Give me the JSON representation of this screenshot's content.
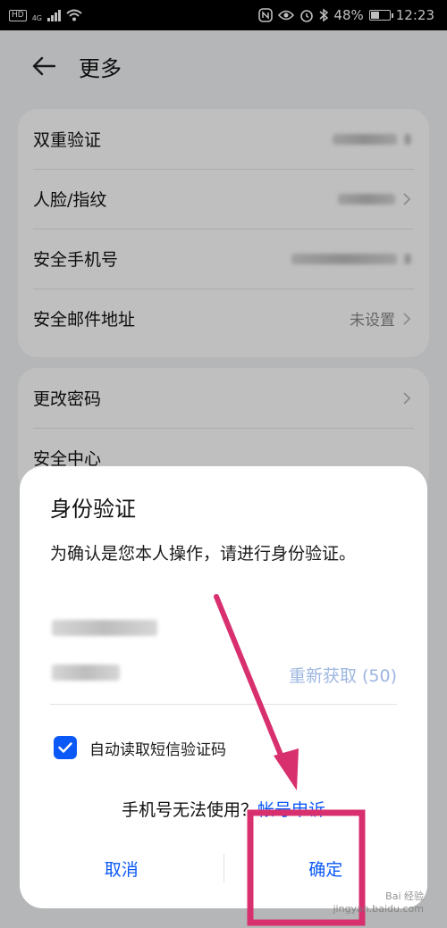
{
  "status_bar": {
    "tag": "HD",
    "network": "4G",
    "battery": "48%",
    "battery_level": 0.48,
    "time": "12:23",
    "icons": [
      "hd-icon",
      "signal-icon",
      "wifi-icon",
      "nfc-icon",
      "eye-icon",
      "alarm-icon",
      "bluetooth-icon",
      "battery-icon"
    ]
  },
  "header": {
    "title": "更多"
  },
  "security_items": [
    {
      "label": "双重验证"
    },
    {
      "label": "人脸/指纹"
    },
    {
      "label": "安全手机号"
    },
    {
      "label": "安全邮件地址",
      "value": "未设置"
    }
  ],
  "other_items": [
    {
      "label": "更改密码"
    },
    {
      "label": "安全中心"
    }
  ],
  "dialog": {
    "title": "身份验证",
    "description": "为确认是您本人操作，请进行身份验证。",
    "resend": "重新获取 (50)",
    "auto_read": "自动读取短信验证码",
    "phone_unusable": "手机号无法使用？",
    "appeal_link": "帐号申诉",
    "cancel": "取消",
    "confirm": "确定"
  },
  "watermark": {
    "brand": "Bai 经验",
    "url": "jingyan.baidu.com"
  },
  "colors": {
    "accent": "#0a59f7",
    "annotation": "#d8306f",
    "resend_disabled": "#9db6e0"
  }
}
